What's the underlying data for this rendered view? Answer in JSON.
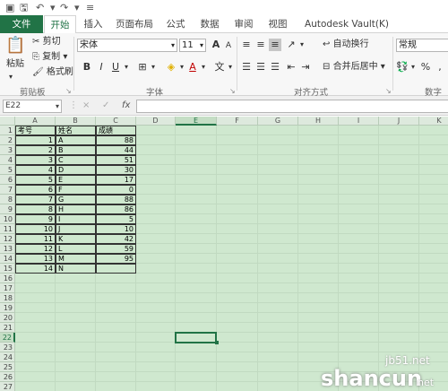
{
  "qat": {
    "save_icon": "save-icon",
    "undo_icon": "undo-icon",
    "redo_icon": "redo-icon"
  },
  "tabs": [
    "文件",
    "开始",
    "插入",
    "页面布局",
    "公式",
    "数据",
    "审阅",
    "视图",
    "Autodesk Vault(K)"
  ],
  "ribbon": {
    "clipboard": {
      "paste": "粘贴",
      "cut": "剪切",
      "copy": "复制",
      "format_painter": "格式刷",
      "label": "剪贴板"
    },
    "font": {
      "font_name": "宋体",
      "font_size": "11",
      "label": "字体",
      "bold": "B",
      "italic": "I",
      "underline": "U",
      "increase": "A",
      "decrease": "A"
    },
    "align": {
      "wrap": "自动换行",
      "merge": "合并后居中",
      "label": "对齐方式"
    },
    "number": {
      "format": "常规",
      "label": "数字",
      "percent": "%"
    }
  },
  "formula_bar": {
    "name_box": "E22",
    "fx": "fx",
    "cancel": "×",
    "enter": "✓"
  },
  "sheet": {
    "columns": [
      "A",
      "B",
      "C",
      "D",
      "E",
      "F",
      "G",
      "H",
      "I",
      "J",
      "K"
    ],
    "rows": [
      "1",
      "2",
      "3",
      "4",
      "5",
      "6",
      "7",
      "8",
      "9",
      "10",
      "11",
      "12",
      "13",
      "14",
      "15",
      "16",
      "17",
      "18",
      "19",
      "20",
      "21",
      "22",
      "23",
      "24",
      "25",
      "26",
      "27"
    ],
    "headers": [
      "考号",
      "姓名",
      "成绩"
    ],
    "data": [
      [
        "1",
        "A",
        "88"
      ],
      [
        "2",
        "B",
        "44"
      ],
      [
        "3",
        "C",
        "51"
      ],
      [
        "4",
        "D",
        "30"
      ],
      [
        "5",
        "E",
        "17"
      ],
      [
        "6",
        "F",
        "0"
      ],
      [
        "7",
        "G",
        "88"
      ],
      [
        "8",
        "H",
        "86"
      ],
      [
        "9",
        "I",
        "5"
      ],
      [
        "10",
        "J",
        "10"
      ],
      [
        "11",
        "K",
        "42"
      ],
      [
        "12",
        "L",
        "59"
      ],
      [
        "13",
        "M",
        "95"
      ],
      [
        "14",
        "N",
        ""
      ]
    ],
    "active_cell": "E22"
  },
  "watermark": {
    "text1": "jb51.net",
    "text2": "shancun",
    "text3": "net"
  }
}
